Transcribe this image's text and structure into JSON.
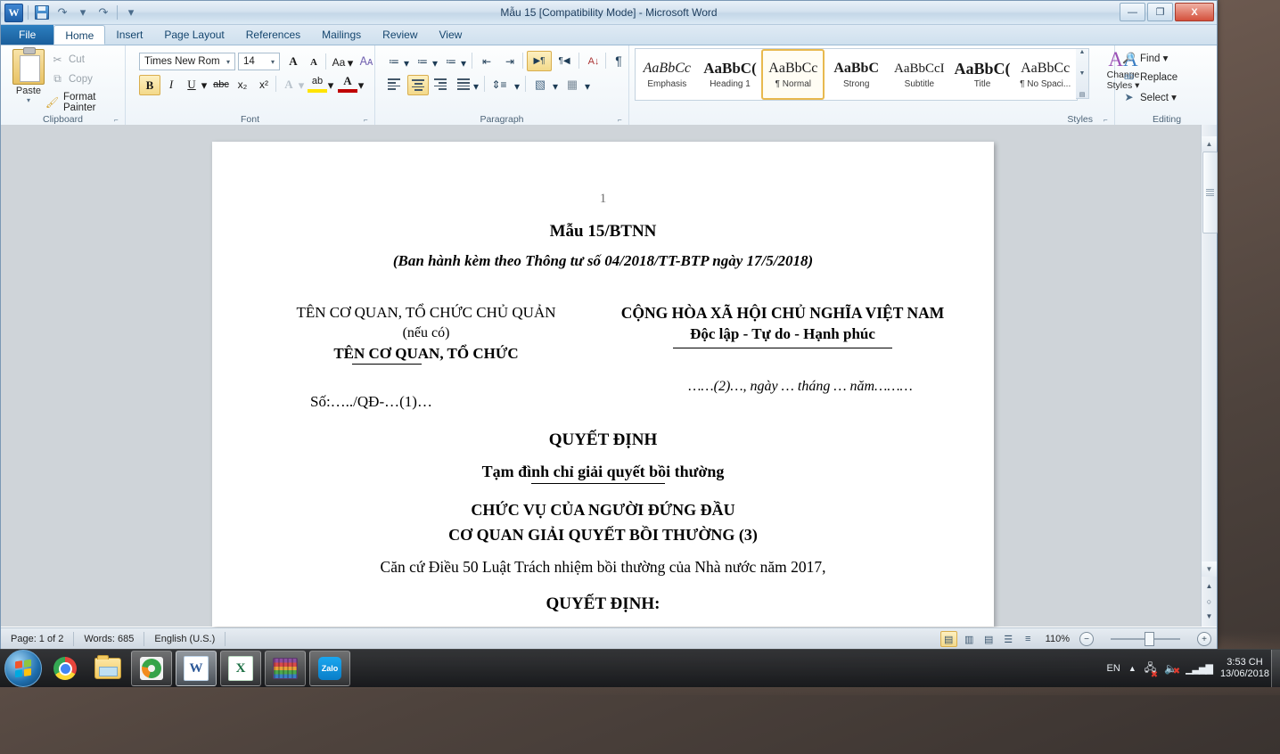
{
  "window": {
    "title": "Mẫu 15 [Compatibility Mode]  -  Microsoft Word",
    "minimize_label": "—",
    "restore_label": "❐",
    "close_label": "X",
    "help_label": "?",
    "collapse_ribbon_label": "^"
  },
  "quick_access": {
    "logo": "W",
    "save_icon": "save-icon",
    "undo_label": "↶",
    "redo_label": "↷",
    "customize_label": "▾"
  },
  "tabs": [
    {
      "label": "File",
      "active": false,
      "kind": "file"
    },
    {
      "label": "Home",
      "active": true,
      "kind": "normal"
    },
    {
      "label": "Insert",
      "active": false,
      "kind": "normal"
    },
    {
      "label": "Page Layout",
      "active": false,
      "kind": "normal"
    },
    {
      "label": "References",
      "active": false,
      "kind": "normal"
    },
    {
      "label": "Mailings",
      "active": false,
      "kind": "normal"
    },
    {
      "label": "Review",
      "active": false,
      "kind": "normal"
    },
    {
      "label": "View",
      "active": false,
      "kind": "normal"
    }
  ],
  "ribbon": {
    "clipboard": {
      "group_label": "Clipboard",
      "paste_label": "Paste",
      "cut_label": "Cut",
      "copy_label": "Copy",
      "format_painter_label": "Format Painter",
      "dialog_launcher": "⌐"
    },
    "font": {
      "group_label": "Font",
      "font_name": "Times New Rom",
      "font_size": "14",
      "grow_font": "A",
      "shrink_font": "A",
      "change_case": "Aa",
      "clear_formatting": "A",
      "bold": "B",
      "italic": "I",
      "underline": "U",
      "strikethrough": "abc",
      "subscript": "x₂",
      "superscript": "x²",
      "text_effects": "A",
      "highlight": "ab",
      "font_color": "A",
      "dialog_launcher": "⌐"
    },
    "paragraph": {
      "group_label": "Paragraph",
      "bullets": "≔",
      "numbering": "≔",
      "multilevel": "≔",
      "decrease_indent": "⇤",
      "increase_indent": "⇥",
      "ltr_text": "▶¶",
      "rtl_text": "¶◀",
      "sort": "A↓",
      "show_marks": "¶",
      "align_left": "align-left",
      "align_center": "align-center",
      "align_right": "align-right",
      "justify": "justify",
      "line_spacing": "line-spacing",
      "shading": "shading",
      "borders": "borders",
      "dialog_launcher": "⌐"
    },
    "styles": {
      "group_label": "Styles",
      "items": [
        {
          "preview": "AaBbCc",
          "name": "Emphasis",
          "selected": false,
          "style": "italic"
        },
        {
          "preview": "AaBbC(",
          "name": "Heading 1",
          "selected": false,
          "style": "heading"
        },
        {
          "preview": "AaBbCc",
          "name": "¶ Normal",
          "selected": true,
          "style": "normal"
        },
        {
          "preview": "AaBbC",
          "name": "Strong",
          "selected": false,
          "style": "strong"
        },
        {
          "preview": "AaBbCcI",
          "name": "Subtitle",
          "selected": false,
          "style": "normal"
        },
        {
          "preview": "AaBbC(",
          "name": "Title",
          "selected": false,
          "style": "title"
        },
        {
          "preview": "AaBbCc",
          "name": "¶ No Spaci...",
          "selected": false,
          "style": "normal"
        }
      ],
      "scroll_up": "▲",
      "scroll_down": "▼",
      "more": "▤",
      "change_styles_label_line1": "Change",
      "change_styles_label_line2": "Styles ▾",
      "dialog_launcher": "⌐"
    },
    "editing": {
      "group_label": "Editing",
      "find_label": "Find ▾",
      "replace_label": "Replace",
      "select_label": "Select ▾"
    }
  },
  "document": {
    "page_number": "1",
    "lines": [
      {
        "id": "form-code",
        "text": "Mẫu 15/BTNN"
      },
      {
        "id": "issued-under",
        "text": "(Ban hành kèm theo Thông tư số 04/2018/TT-BTP ngày 17/5/2018)"
      },
      {
        "id": "org-parent",
        "text": "TÊN CƠ QUAN, TỔ CHỨC CHỦ QUẢN"
      },
      {
        "id": "org-parent-note",
        "text": "(nếu có)"
      },
      {
        "id": "org-name",
        "text": "TÊN CƠ QUAN, TỔ CHỨC"
      },
      {
        "id": "national-title",
        "text": "CỘNG HÒA XÃ HỘI CHỦ NGHĨA VIỆT NAM"
      },
      {
        "id": "national-motto",
        "text": "Độc lập - Tự do - Hạnh phúc"
      },
      {
        "id": "doc-number",
        "text": "Số:…../QĐ-…(1)…"
      },
      {
        "id": "place-date",
        "text": "……(2)…, ngày … tháng … năm………"
      },
      {
        "id": "decision-heading",
        "text": "QUYẾT ĐỊNH"
      },
      {
        "id": "decision-subject",
        "text": "Tạm đình chỉ giải quyết bồi thường"
      },
      {
        "id": "position-line1",
        "text": "CHỨC VỤ CỦA NGƯỜI ĐỨNG ĐẦU"
      },
      {
        "id": "position-line2",
        "text": "CƠ QUAN GIẢI QUYẾT BỒI THƯỜNG (3)"
      },
      {
        "id": "legal-basis",
        "text": "Căn cứ Điều 50 Luật Trách nhiệm bồi thường của Nhà nước năm 2017,"
      },
      {
        "id": "decides",
        "text": "QUYẾT ĐỊNH:"
      }
    ]
  },
  "status_bar": {
    "page": "Page: 1 of 2",
    "words": "Words: 685",
    "language": "English (U.S.)",
    "views": [
      {
        "name": "print-layout",
        "glyph": "▤",
        "selected": true
      },
      {
        "name": "full-screen-reading",
        "glyph": "📖",
        "selected": false
      },
      {
        "name": "web-layout",
        "glyph": "▤",
        "selected": false
      },
      {
        "name": "outline",
        "glyph": "▤",
        "selected": false
      },
      {
        "name": "draft",
        "glyph": "▤",
        "selected": false
      }
    ],
    "zoom": "110%",
    "zoom_out": "−",
    "zoom_in": "+"
  },
  "scrollbar": {
    "up_arrow": "▲",
    "down_arrow": "▼",
    "previous_page": "▲",
    "select_browse_object": "○",
    "next_page": "▼"
  },
  "taskbar": {
    "start": "start-orb",
    "items": [
      {
        "name": "chrome",
        "label": "Google Chrome",
        "state": "pinned"
      },
      {
        "name": "explorer",
        "label": "Windows Explorer",
        "state": "pinned"
      },
      {
        "name": "unikey",
        "label": "Unikey",
        "state": "open"
      },
      {
        "name": "word",
        "label": "Microsoft Word",
        "state": "active"
      },
      {
        "name": "excel",
        "label": "Microsoft Excel",
        "state": "open"
      },
      {
        "name": "winrar",
        "label": "WinRAR",
        "state": "open"
      },
      {
        "name": "zalo",
        "label": "Zalo",
        "state": "open"
      }
    ],
    "tray": {
      "language": "EN",
      "show_hidden": "▲",
      "network_icon": "network-icon",
      "volume_icon": "volume-icon",
      "signal_icon": "signal-icon",
      "time": "3:53 CH",
      "date": "13/06/2018"
    }
  },
  "colors": {
    "accent": "#2c7fc0",
    "selection": "#f3d98a",
    "page_background": "#cfd4d9"
  }
}
